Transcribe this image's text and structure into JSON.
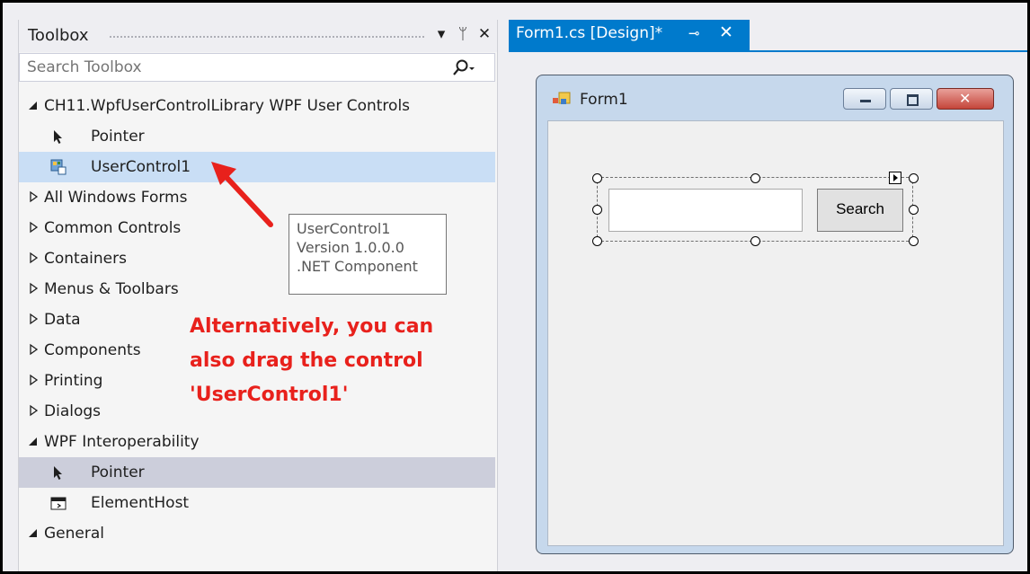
{
  "toolbox": {
    "title": "Toolbox",
    "search_placeholder": "Search Toolbox",
    "items": [
      {
        "label": "CH11.WpfUserControlLibrary WPF User Controls",
        "type": "group-open"
      },
      {
        "label": "Pointer",
        "type": "item",
        "icon": "pointer-icon"
      },
      {
        "label": "UserControl1",
        "type": "item",
        "icon": "usercontrol-icon",
        "selected": true
      },
      {
        "label": "All Windows Forms",
        "type": "group-closed"
      },
      {
        "label": "Common Controls",
        "type": "group-closed"
      },
      {
        "label": "Containers",
        "type": "group-closed"
      },
      {
        "label": "Menus & Toolbars",
        "type": "group-closed"
      },
      {
        "label": "Data",
        "type": "group-closed"
      },
      {
        "label": "Components",
        "type": "group-closed"
      },
      {
        "label": "Printing",
        "type": "group-closed"
      },
      {
        "label": "Dialogs",
        "type": "group-closed"
      },
      {
        "label": "WPF Interoperability",
        "type": "group-open"
      },
      {
        "label": "Pointer",
        "type": "item",
        "icon": "pointer-icon",
        "hover": true
      },
      {
        "label": "ElementHost",
        "type": "item",
        "icon": "elementhost-icon"
      },
      {
        "label": "General",
        "type": "group-open"
      }
    ]
  },
  "tooltip": {
    "line1": "UserControl1",
    "line2": "Version 1.0.0.0",
    "line3": ".NET Component"
  },
  "annotation": {
    "line1": "Alternatively, you can",
    "line2": "also drag the control",
    "line3": "'UserControl1'"
  },
  "designer": {
    "tab_title": "Form1.cs [Design]*",
    "form_title": "Form1",
    "search_button_label": "Search"
  },
  "colors": {
    "accent": "#007acc",
    "selection": "#c9def5",
    "annotation": "#e8211c"
  }
}
